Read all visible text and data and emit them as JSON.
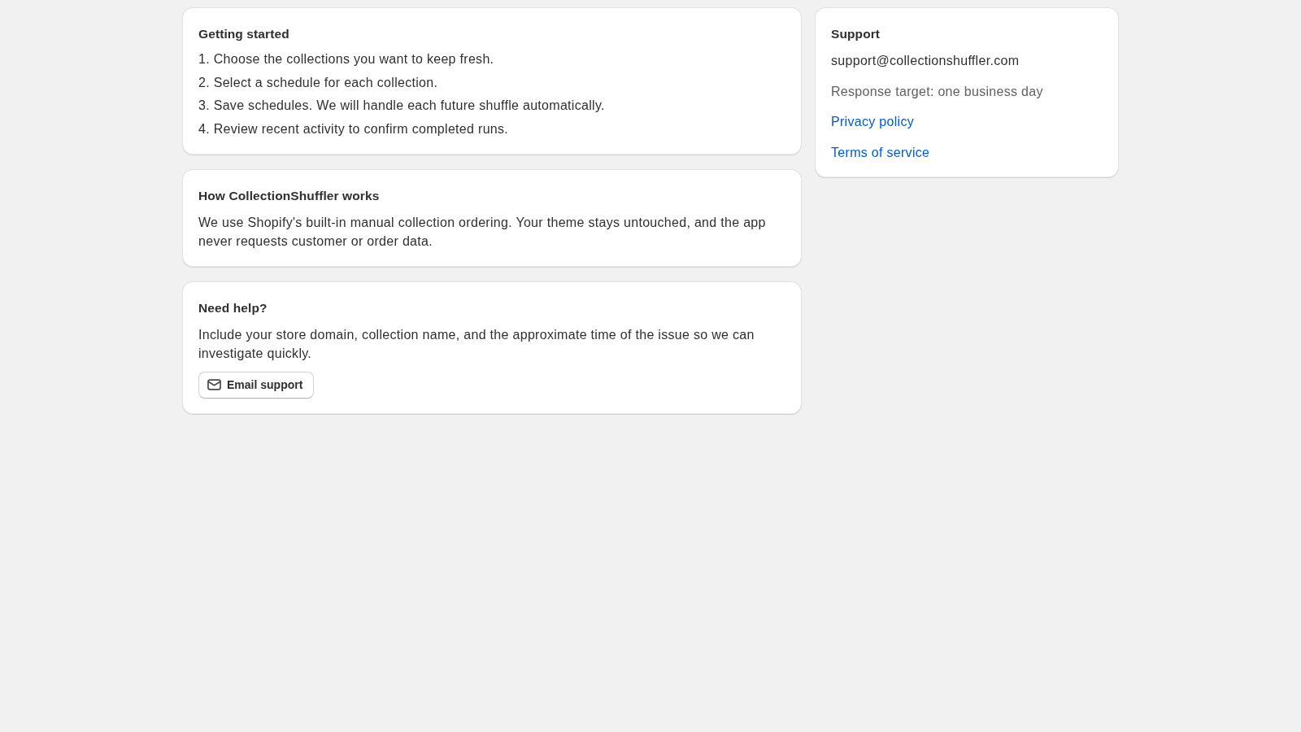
{
  "cards": [
    {
      "kind": "steps",
      "title": "Getting started",
      "steps": [
        "1. Choose the collections you want to keep fresh.",
        "2. Select a schedule for each collection.",
        "3. Save schedules. We will handle each future shuffle automatically.",
        "4. Review recent activity to confirm completed runs."
      ]
    },
    {
      "kind": "text",
      "title": "How CollectionShuffler works",
      "text": "We use Shopify's built-in manual collection ordering. Your theme stays untouched, and the app never requests customer or order data."
    },
    {
      "kind": "text_with_button",
      "title": "Need help?",
      "text": "Include your store domain, collection name, and the approximate time of the issue so we can investigate quickly.",
      "button": {
        "label": "Email support"
      }
    }
  ],
  "support": {
    "title": "Support",
    "email": "support@collectionshuffler.com",
    "response_target": "Response target: one business day",
    "links": [
      "Privacy policy",
      "Terms of service"
    ]
  }
}
